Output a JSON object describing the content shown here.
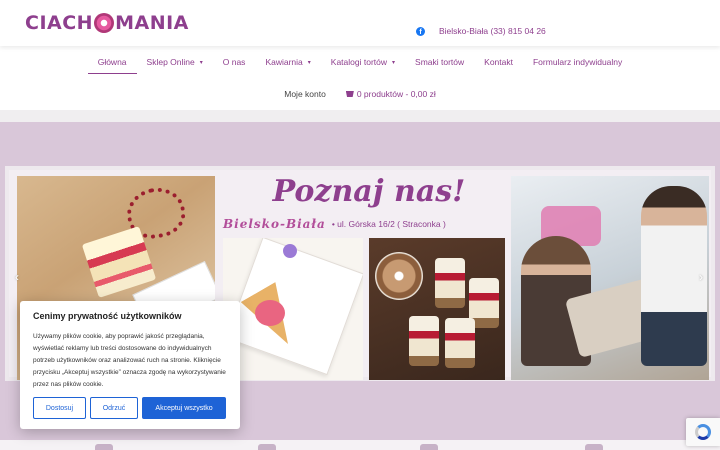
{
  "brand": {
    "logo_text_left": "CIACH",
    "logo_text_right": "MANIA"
  },
  "header": {
    "facebook_icon": "facebook-icon",
    "contact_text": "Bielsko-Biała (33) 815 04 26"
  },
  "nav": {
    "items": [
      {
        "label": "Główna",
        "dropdown": false,
        "active": true
      },
      {
        "label": "Sklep Online",
        "dropdown": true
      },
      {
        "label": "O nas",
        "dropdown": false
      },
      {
        "label": "Kawiarnia",
        "dropdown": true
      },
      {
        "label": "Katalogi tortów",
        "dropdown": true
      },
      {
        "label": "Smaki tortów",
        "dropdown": false
      },
      {
        "label": "Kontakt",
        "dropdown": false
      },
      {
        "label": "Formularz indywidualny",
        "dropdown": false
      }
    ],
    "account": "Moje konto",
    "cart": "0 produktów - 0,00 zł",
    "caret": "▾"
  },
  "hero": {
    "title": "Poznaj nas!",
    "city": "Bielsko-Biała",
    "address": "• ul. Górska 16/2  ( Straconka )",
    "prev_arrow": "‹",
    "next_arrow": "›"
  },
  "cookie": {
    "title": "Cenimy prywatność użytkowników",
    "text": "Używamy plików cookie, aby poprawić jakość przeglądania, wyświetlać reklamy lub treści dostosowane do indywidualnych potrzeb użytkowników oraz analizować ruch na stronie. Kliknięcie przycisku „Akceptuj wszystkie” oznacza zgodę na wykorzystywanie przez nas plików cookie.",
    "customize": "Dostosuj",
    "reject": "Odrzuć",
    "accept": "Akceptuj wszystko"
  },
  "colors": {
    "brand_purple": "#8e3f8e",
    "hero_bg": "#d9c7d9",
    "button_blue": "#1e63d6"
  }
}
